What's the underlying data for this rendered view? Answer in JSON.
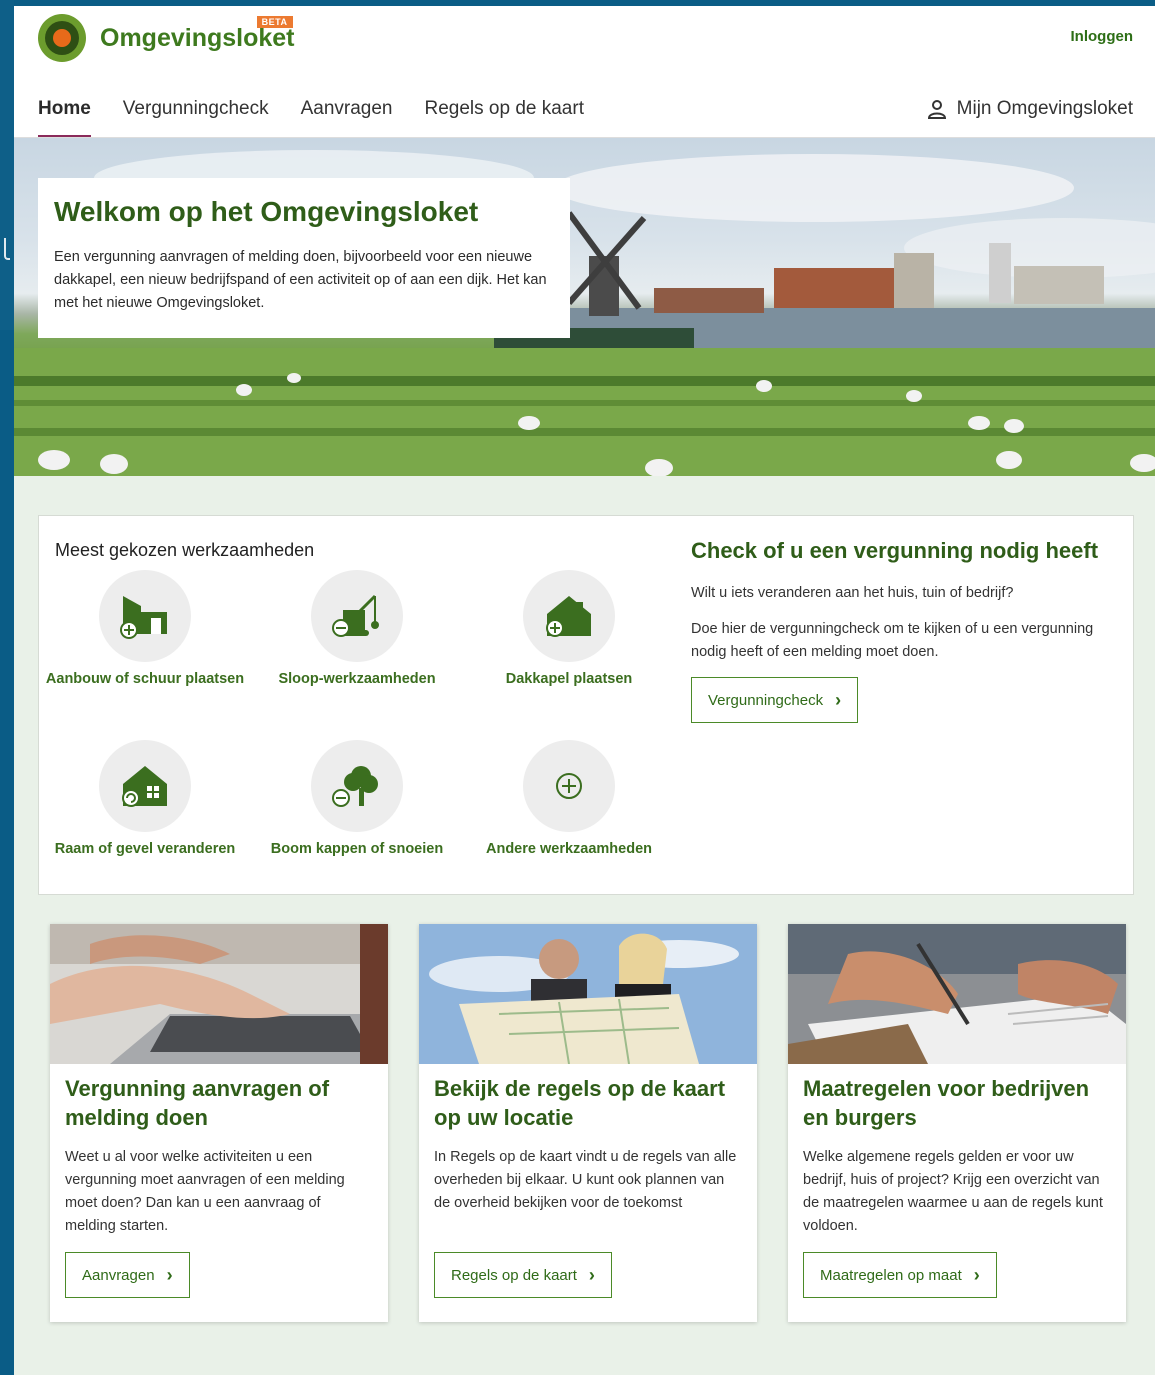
{
  "header": {
    "logo_text": "Omgevingsloket",
    "beta_label": "BETA",
    "login_label": "Inloggen",
    "account_label": "Mijn Omgevingsloket"
  },
  "nav": {
    "items": [
      {
        "label": "Home",
        "active": true
      },
      {
        "label": "Vergunningcheck",
        "active": false
      },
      {
        "label": "Aanvragen",
        "active": false
      },
      {
        "label": "Regels op de kaart",
        "active": false
      }
    ]
  },
  "hero": {
    "title": "Welkom op het Omgevingsloket",
    "text": "Een vergunning aanvragen of melding doen, bijvoorbeeld voor een nieuwe dakkapel, een nieuw bedrijfspand of een activiteit op of aan een dijk. Het kan met het nieuwe Omgevingsloket."
  },
  "works": {
    "title": "Meest gekozen werkzaamheden",
    "items": [
      {
        "label": "Aanbouw of schuur plaatsen",
        "icon": "extension-shed-icon"
      },
      {
        "label": "Sloop-werkzaamheden",
        "icon": "demolition-crane-icon"
      },
      {
        "label": "Dakkapel plaatsen",
        "icon": "dormer-house-icon"
      },
      {
        "label": "Raam of gevel veranderen",
        "icon": "window-facade-icon"
      },
      {
        "label": "Boom kappen of snoeien",
        "icon": "tree-cut-icon"
      },
      {
        "label": "Andere werkzaamheden",
        "icon": "plus-circle-icon"
      }
    ]
  },
  "check": {
    "title": "Check of u een vergunning nodig heeft",
    "text1": "Wilt u iets veranderen aan het huis, tuin of bedrijf?",
    "text2": "Doe hier de vergunningcheck om te kijken of u een vergunning nodig heeft of een melding moet doen.",
    "button": "Vergunningcheck"
  },
  "cards": [
    {
      "title": "Vergunning aanvragen of melding doen",
      "text": "Weet u al voor welke activiteiten u een vergunning moet aanvragen of een melding moet doen? Dan kan u een aanvraag of melding starten.",
      "button": "Aanvragen"
    },
    {
      "title": "Bekijk de regels op de kaart op uw locatie",
      "text": "In Regels op de kaart vindt u de regels van alle overheden bij elkaar. U kunt ook plannen van de overheid bekijken voor de toekomst",
      "button": "Regels op de kaart"
    },
    {
      "title": "Maatregelen voor bedrijven en burgers",
      "text": "Welke algemene regels gelden er voor uw bedrijf, huis of project? Krijg een overzicht van de maatregelen waarmee u aan de regels kunt voldoen.",
      "button": "Maatregelen op maat"
    }
  ],
  "colors": {
    "brand_green": "#2f5d19",
    "accent_orange": "#ec7a31",
    "nav_underline": "#8a2a5a",
    "frame_blue": "#0b5d86"
  }
}
